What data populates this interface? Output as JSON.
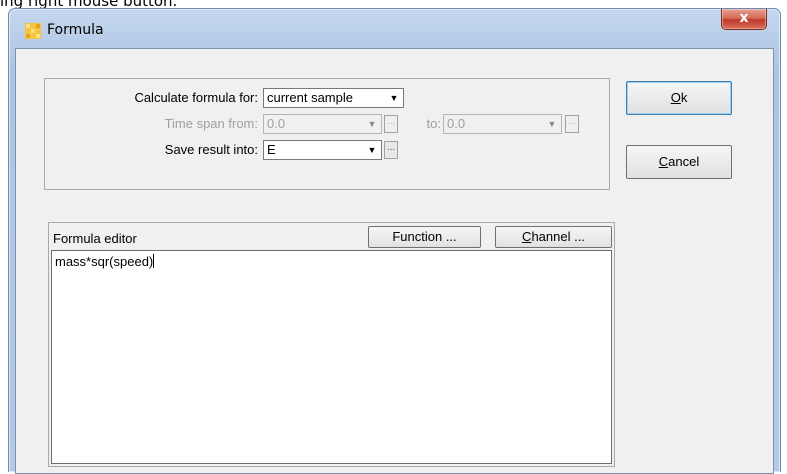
{
  "background_text": "ing right mouse button.",
  "window": {
    "title": "Formula",
    "close_label": "x"
  },
  "calc": {
    "label": "Calculate formula for:",
    "value": "current sample"
  },
  "timespan": {
    "from_label": "Time span from:",
    "from_value": "0.0",
    "to_label": "to:",
    "to_value": "0.0"
  },
  "save": {
    "label": "Save result into:",
    "value": "E"
  },
  "buttons": {
    "ok_mnemonic": "O",
    "ok_rest": "k",
    "cancel_mnemonic": "C",
    "cancel_rest": "ancel",
    "function_label": "Function ...",
    "channel_mnemonic": "C",
    "channel_rest": "hannel ..."
  },
  "editor": {
    "label": "Formula editor",
    "text": "mass*sqr(speed)"
  },
  "icons": {
    "dropdown": "▼",
    "ellipsis": "..."
  }
}
